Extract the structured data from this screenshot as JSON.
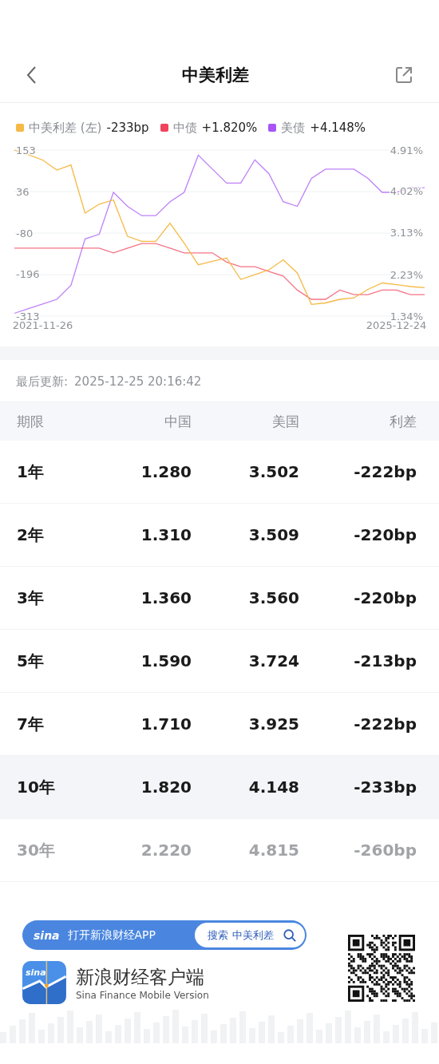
{
  "nav": {
    "title": "中美利差"
  },
  "legend": [
    {
      "value": "-233bp"
    },
    {
      "value": "+1.820%"
    },
    {
      "value": "+4.148%"
    }
  ],
  "chart": {
    "chart_data": {
      "type": "line",
      "categories": [
        null,
        null,
        "2021-11-26",
        null,
        null,
        null,
        null,
        null,
        null,
        null,
        null,
        null,
        null,
        null,
        null,
        null,
        null,
        null,
        null,
        null,
        null,
        null,
        null,
        null,
        null,
        null,
        null,
        "2025-12-24",
        null,
        null
      ],
      "grid": true,
      "ylim": [
        -313,
        153
      ],
      "yticks": [
        {
          "value": 153,
          "label": "153"
        },
        {
          "value": 36,
          "label": "36"
        },
        {
          "value": -80,
          "label": "-80"
        },
        {
          "value": -196,
          "label": "-196"
        },
        {
          "value": -313,
          "label": "-313"
        }
      ],
      "y2lim": [
        1.34,
        4.91
      ],
      "y2ticks": [
        {
          "value": 4.91,
          "label": "4.91%"
        },
        {
          "value": 4.02,
          "label": "4.02%"
        },
        {
          "value": 3.13,
          "label": "3.13%"
        },
        {
          "value": 2.23,
          "label": "2.23%"
        },
        {
          "value": 1.34,
          "label": "1.34%"
        }
      ],
      "series": [
        {
          "name": "中美利差 (左)",
          "color": "#f5b945",
          "values": [
            153,
            140,
            125,
            97,
            111,
            -24,
            1,
            13,
            -89,
            -103,
            -103,
            -52,
            -108,
            -169,
            -159,
            -150,
            -210,
            -197,
            -183,
            -155,
            -192,
            -280,
            -276,
            -266,
            -262,
            -238,
            -220,
            -225,
            -230,
            -233
          ]
        },
        {
          "name": "中债",
          "color": "#f0445c",
          "axis": "y2",
          "values": [
            2.8,
            2.8,
            2.8,
            2.8,
            2.8,
            2.8,
            2.8,
            2.7,
            2.8,
            2.9,
            2.9,
            2.8,
            2.7,
            2.7,
            2.7,
            2.5,
            2.4,
            2.4,
            2.3,
            2.2,
            1.9,
            1.7,
            1.7,
            1.9,
            1.8,
            1.8,
            1.9,
            1.9,
            1.8,
            1.8
          ]
        },
        {
          "name": "美债",
          "color": "#a855f7",
          "axis": "y2",
          "values": [
            1.4,
            1.5,
            1.6,
            1.7,
            2.0,
            3.0,
            3.1,
            4.0,
            3.7,
            3.5,
            3.5,
            3.8,
            4.0,
            4.8,
            4.5,
            4.2,
            4.2,
            4.7,
            4.4,
            3.8,
            3.7,
            4.3,
            4.5,
            4.5,
            4.5,
            4.3,
            4.0,
            4.0,
            4.1,
            4.1
          ]
        }
      ]
    }
  },
  "updated": {
    "label": "最后更新:",
    "time": "2025-12-25 20:16:42"
  },
  "table": {
    "columns": [
      "期限",
      "中国",
      "美国",
      "利差"
    ],
    "rows": [
      {
        "term": "1年",
        "china": "1.280",
        "us": "3.502",
        "spread": "-222bp",
        "selected": false,
        "dimmed": false
      },
      {
        "term": "2年",
        "china": "1.310",
        "us": "3.509",
        "spread": "-220bp",
        "selected": false,
        "dimmed": false
      },
      {
        "term": "3年",
        "china": "1.360",
        "us": "3.560",
        "spread": "-220bp",
        "selected": false,
        "dimmed": false
      },
      {
        "term": "5年",
        "china": "1.590",
        "us": "3.724",
        "spread": "-213bp",
        "selected": false,
        "dimmed": false
      },
      {
        "term": "7年",
        "china": "1.710",
        "us": "3.925",
        "spread": "-222bp",
        "selected": false,
        "dimmed": false
      },
      {
        "term": "10年",
        "china": "1.820",
        "us": "4.148",
        "spread": "-233bp",
        "selected": true,
        "dimmed": false
      },
      {
        "term": "30年",
        "china": "2.220",
        "us": "4.815",
        "spread": "-260bp",
        "selected": false,
        "dimmed": true
      }
    ]
  },
  "footer": {
    "banner_logo": "sina",
    "banner_text": "打开新浪财经APP",
    "search_label": "搜索",
    "search_term": "中美利差",
    "app_logo": "sina",
    "app_name": "新浪财经客户端",
    "app_subtitle": "Sina Finance Mobile Version"
  }
}
